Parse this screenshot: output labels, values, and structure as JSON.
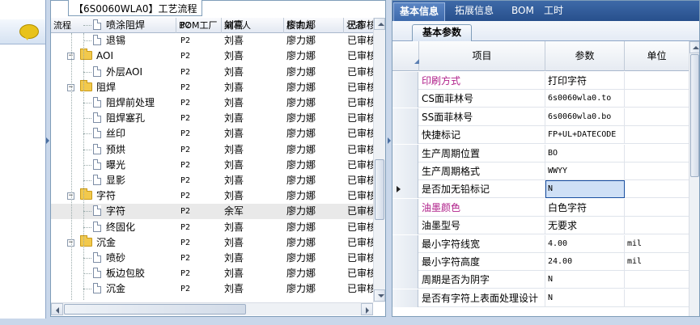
{
  "tree_panel": {
    "title": "【6S0060WLA0】工艺流程",
    "columns": [
      "流程",
      "BOM工厂",
      "编写人",
      "核审人",
      "状态"
    ],
    "rows": [
      {
        "kind": "leaf",
        "name": "喷涂阻焊",
        "plant": "P2",
        "writer": "刘喜",
        "reviewer": "廖力娜",
        "status": "已审核"
      },
      {
        "kind": "leaf",
        "name": "退锡",
        "plant": "P2",
        "writer": "刘喜",
        "reviewer": "廖力娜",
        "status": "已审核"
      },
      {
        "kind": "group",
        "name": "AOI",
        "plant": "P2",
        "writer": "刘喜",
        "reviewer": "廖力娜",
        "status": "已审核"
      },
      {
        "kind": "leaf",
        "name": "外层AOI",
        "plant": "P2",
        "writer": "刘喜",
        "reviewer": "廖力娜",
        "status": "已审核"
      },
      {
        "kind": "group",
        "name": "阻焊",
        "plant": "P2",
        "writer": "刘喜",
        "reviewer": "廖力娜",
        "status": "已审核"
      },
      {
        "kind": "leaf",
        "name": "阻焊前处理",
        "plant": "P2",
        "writer": "刘喜",
        "reviewer": "廖力娜",
        "status": "已审核"
      },
      {
        "kind": "leaf",
        "name": "阻焊塞孔",
        "plant": "P2",
        "writer": "刘喜",
        "reviewer": "廖力娜",
        "status": "已审核"
      },
      {
        "kind": "leaf",
        "name": "丝印",
        "plant": "P2",
        "writer": "刘喜",
        "reviewer": "廖力娜",
        "status": "已审核"
      },
      {
        "kind": "leaf",
        "name": "预烘",
        "plant": "P2",
        "writer": "刘喜",
        "reviewer": "廖力娜",
        "status": "已审核"
      },
      {
        "kind": "leaf",
        "name": "曝光",
        "plant": "P2",
        "writer": "刘喜",
        "reviewer": "廖力娜",
        "status": "已审核"
      },
      {
        "kind": "leaf",
        "name": "显影",
        "plant": "P2",
        "writer": "刘喜",
        "reviewer": "廖力娜",
        "status": "已审核"
      },
      {
        "kind": "group",
        "name": "字符",
        "plant": "P2",
        "writer": "刘喜",
        "reviewer": "廖力娜",
        "status": "已审核"
      },
      {
        "kind": "leaf",
        "name": "字符",
        "plant": "P2",
        "writer": "余军",
        "reviewer": "廖力娜",
        "status": "已审核",
        "selected": true
      },
      {
        "kind": "leaf",
        "name": "终固化",
        "plant": "P2",
        "writer": "刘喜",
        "reviewer": "廖力娜",
        "status": "已审核"
      },
      {
        "kind": "group",
        "name": "沉金",
        "plant": "P2",
        "writer": "刘喜",
        "reviewer": "廖力娜",
        "status": "已审核"
      },
      {
        "kind": "leaf",
        "name": "喷砂",
        "plant": "P2",
        "writer": "刘喜",
        "reviewer": "廖力娜",
        "status": "已审核"
      },
      {
        "kind": "leaf",
        "name": "板边包胶",
        "plant": "P2",
        "writer": "刘喜",
        "reviewer": "廖力娜",
        "status": "已审核"
      },
      {
        "kind": "leaf",
        "name": "沉金",
        "plant": "P2",
        "writer": "刘喜",
        "reviewer": "廖力娜",
        "status": "已审核"
      }
    ]
  },
  "right_panel": {
    "tabs": [
      "基本信息",
      "拓展信息",
      "BOM",
      "工时"
    ],
    "active_tab": "基本信息",
    "subtab": "基本参数",
    "columns": [
      "项目",
      "参数",
      "单位"
    ],
    "rows": [
      {
        "item": "印刷方式",
        "value": "打印字符",
        "unit": "",
        "item_color": "#b0208a",
        "value_cn": true
      },
      {
        "item": "CS面菲林号",
        "value": "6s0060wla0.to",
        "unit": ""
      },
      {
        "item": "SS面菲林号",
        "value": "6s0060wla0.bo",
        "unit": ""
      },
      {
        "item": "快捷标记",
        "value": "FP+UL+DATECODE",
        "unit": ""
      },
      {
        "item": "生产周期位置",
        "value": "BO",
        "unit": ""
      },
      {
        "item": "生产周期格式",
        "value": "WWYY",
        "unit": ""
      },
      {
        "item": "是否加无铅标记",
        "value": "N",
        "unit": "",
        "current": true
      },
      {
        "item": "油墨颜色",
        "value": "白色字符",
        "unit": "",
        "item_color": "#b0208a",
        "value_cn": true
      },
      {
        "item": "油墨型号",
        "value": "无要求",
        "unit": "",
        "value_cn": true
      },
      {
        "item": "最小字符线宽",
        "value": "4.00",
        "unit": "mil"
      },
      {
        "item": "最小字符高度",
        "value": "24.00",
        "unit": "mil"
      },
      {
        "item": "周期是否为阴字",
        "value": "N",
        "unit": ""
      },
      {
        "item": "是否有字符上表面处理设计",
        "value": "N",
        "unit": ""
      }
    ]
  },
  "icons": {
    "chat": "speech-bubble-icon",
    "folder": "folder-icon",
    "leaf": "document-icon"
  },
  "colors": {
    "tab_bar": "#2f5b98",
    "highlight_item": "#b0208a",
    "selected_cell": "#cfe0f6"
  }
}
